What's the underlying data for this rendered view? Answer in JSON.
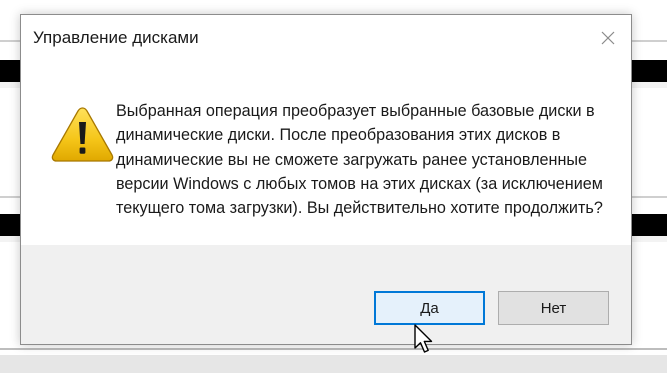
{
  "dialog": {
    "title": "Управление дисками",
    "close_icon": "close-icon",
    "warning_icon": "warning-icon",
    "message": "Выбранная операция преобразует выбранные базовые диски в\nдинамические диски. После преобразования этих дисков в\nдинамические вы не сможете загружать ранее установленные\nверсии Windows с любых томов на этих дисках (за исключением\nтекущего тома загрузки). Вы действительно хотите продолжить?",
    "buttons": {
      "yes_label": "Да",
      "no_label": "Нет"
    }
  },
  "colors": {
    "accent": "#0078d7",
    "footer_bg": "#f0f0f0",
    "warning_fill": "#f5c518"
  },
  "cursor_icon": "arrow-pointer-icon"
}
